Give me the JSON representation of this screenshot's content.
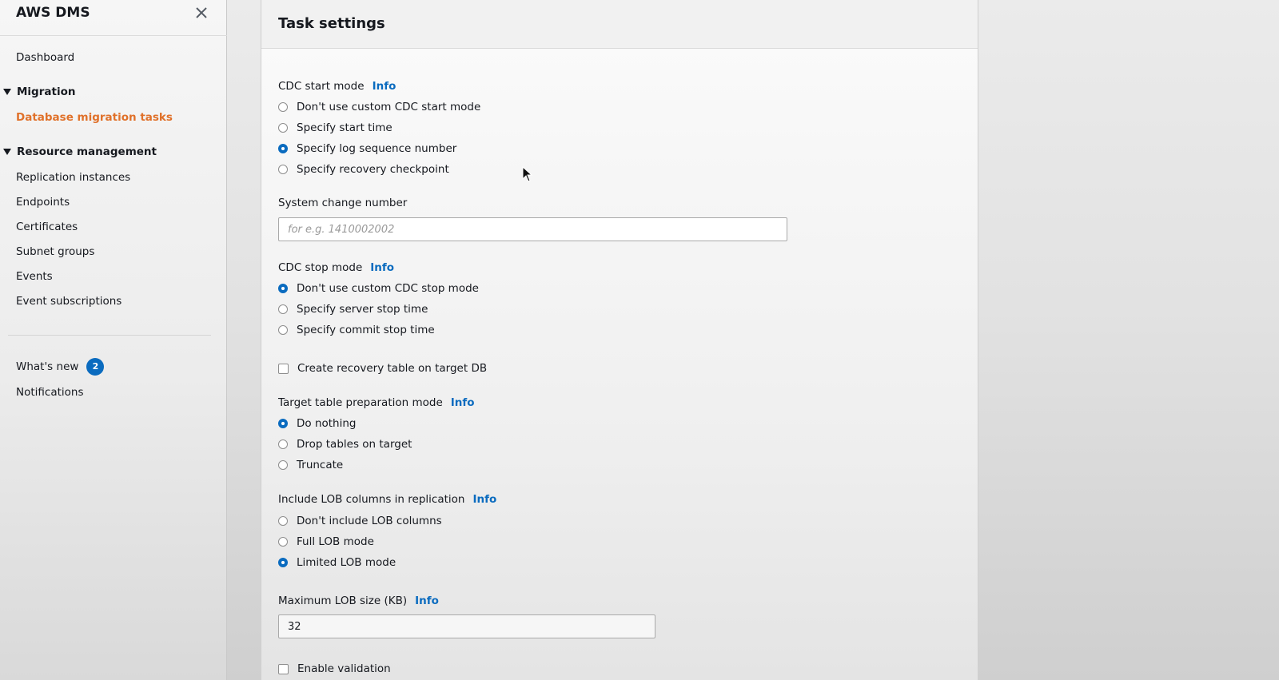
{
  "sidebar": {
    "brand": "AWS DMS",
    "close_icon": "close-icon",
    "items": {
      "dashboard": "Dashboard",
      "migration": "Migration",
      "database_migration_tasks": "Database migration tasks",
      "resource_management": "Resource management",
      "replication_instances": "Replication instances",
      "endpoints": "Endpoints",
      "certificates": "Certificates",
      "subnet_groups": "Subnet groups",
      "events": "Events",
      "event_subscriptions": "Event subscriptions",
      "whats_new": "What's new",
      "whats_new_badge": "2",
      "notifications": "Notifications"
    }
  },
  "panel": {
    "title": "Task settings",
    "info_label": "Info",
    "cdc_start": {
      "label": "CDC start mode",
      "options": [
        "Don't use custom CDC start mode",
        "Specify start time",
        "Specify log sequence number",
        "Specify recovery checkpoint"
      ],
      "selected": "Specify log sequence number"
    },
    "system_change_number": {
      "label": "System change number",
      "placeholder": "for e.g. 1410002002"
    },
    "cdc_stop": {
      "label": "CDC stop mode",
      "options": [
        "Don't use custom CDC stop mode",
        "Specify server stop time",
        "Specify commit stop time"
      ],
      "selected": "Don't use custom CDC stop mode"
    },
    "recovery_table": {
      "label": "Create recovery table on target DB",
      "checked": false
    },
    "target_prep": {
      "label": "Target table preparation mode",
      "options": [
        "Do nothing",
        "Drop tables on target",
        "Truncate"
      ],
      "selected": "Do nothing"
    },
    "lob": {
      "label": "Include LOB columns in replication",
      "options": [
        "Don't include LOB columns",
        "Full LOB mode",
        "Limited LOB mode"
      ],
      "selected": "Limited LOB mode"
    },
    "max_lob": {
      "label": "Maximum LOB size (KB)",
      "value": "32"
    },
    "validation": {
      "label": "Enable validation",
      "checked": false
    }
  },
  "colors": {
    "accent": "#0a6bbf",
    "active_nav": "#e0712a"
  }
}
